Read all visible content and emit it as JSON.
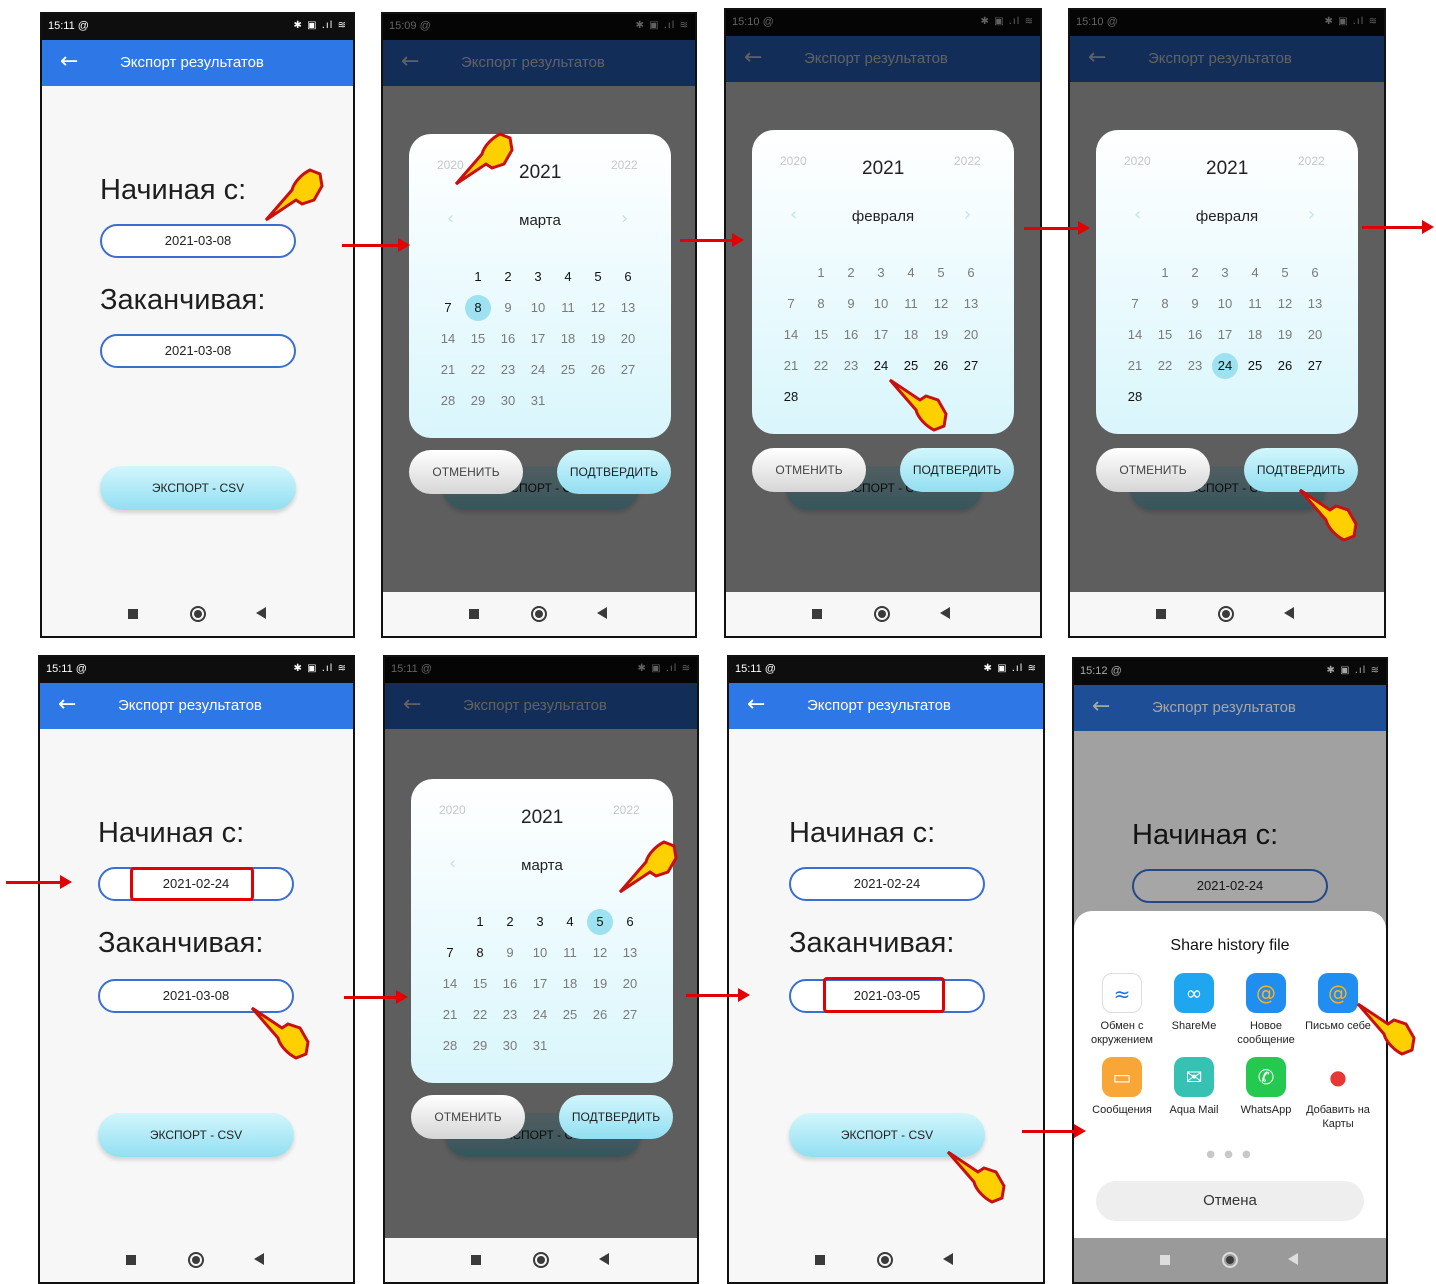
{
  "status_icons": "✱ ▣ .ıl ≋",
  "app_title": "Экспорт результатов",
  "labels": {
    "start": "Начиная с:",
    "end": "Заканчивая:",
    "export": "ЭКСПОРТ - CSV"
  },
  "dialog": {
    "cancel": "ОТМЕНИТЬ",
    "confirm": "ПОДТВЕРДИТЬ",
    "prev_year": "2020",
    "year": "2021",
    "next_year": "2022"
  },
  "months": {
    "march": "марта",
    "february": "февраля"
  },
  "march_days": [
    "1",
    "2",
    "3",
    "4",
    "5",
    "6",
    "7",
    "8",
    "9",
    "10",
    "11",
    "12",
    "13",
    "14",
    "15",
    "16",
    "17",
    "18",
    "19",
    "20",
    "21",
    "22",
    "23",
    "24",
    "25",
    "26",
    "27",
    "28",
    "29",
    "30",
    "31"
  ],
  "feb_days": [
    "1",
    "2",
    "3",
    "4",
    "5",
    "6",
    "7",
    "8",
    "9",
    "10",
    "11",
    "12",
    "13",
    "14",
    "15",
    "16",
    "17",
    "18",
    "19",
    "20",
    "21",
    "22",
    "23",
    "24",
    "25",
    "26",
    "27",
    "28"
  ],
  "screens": [
    {
      "time": "15:11 @",
      "start": "2021-03-08",
      "end": "2021-03-08"
    },
    {
      "time": "15:09 @",
      "selected_day": 8
    },
    {
      "time": "15:10 @"
    },
    {
      "time": "15:10 @",
      "selected_day": 24
    },
    {
      "time": "15:11 @",
      "start": "2021-02-24",
      "end": "2021-03-08"
    },
    {
      "time": "15:11 @",
      "selected_day": 5
    },
    {
      "time": "15:11 @",
      "start": "2021-02-24",
      "end": "2021-03-05"
    },
    {
      "time": "15:12 @",
      "start": "2021-02-24"
    }
  ],
  "share": {
    "title": "Share history file",
    "apps": [
      {
        "name": "Обмен с окружением",
        "icon": "nearby-share-icon",
        "color": "#ffffff"
      },
      {
        "name": "ShareMe",
        "icon": "shareme-icon",
        "color": "#1fa6f0"
      },
      {
        "name": "Новое сообщение",
        "icon": "new-mail-icon",
        "color": "#1f8ef0"
      },
      {
        "name": "Письмо себе",
        "icon": "mail-self-icon",
        "color": "#1f8ef0"
      },
      {
        "name": "Сообщения",
        "icon": "messages-icon",
        "color": "#f7a637"
      },
      {
        "name": "Aqua Mail",
        "icon": "aqua-mail-icon",
        "color": "#36c2b2"
      },
      {
        "name": "WhatsApp",
        "icon": "whatsapp-icon",
        "color": "#25c94f"
      },
      {
        "name": "Добавить на Карты",
        "icon": "maps-pin-icon",
        "color": "#ffffff"
      }
    ],
    "cancel": "Отмена"
  }
}
